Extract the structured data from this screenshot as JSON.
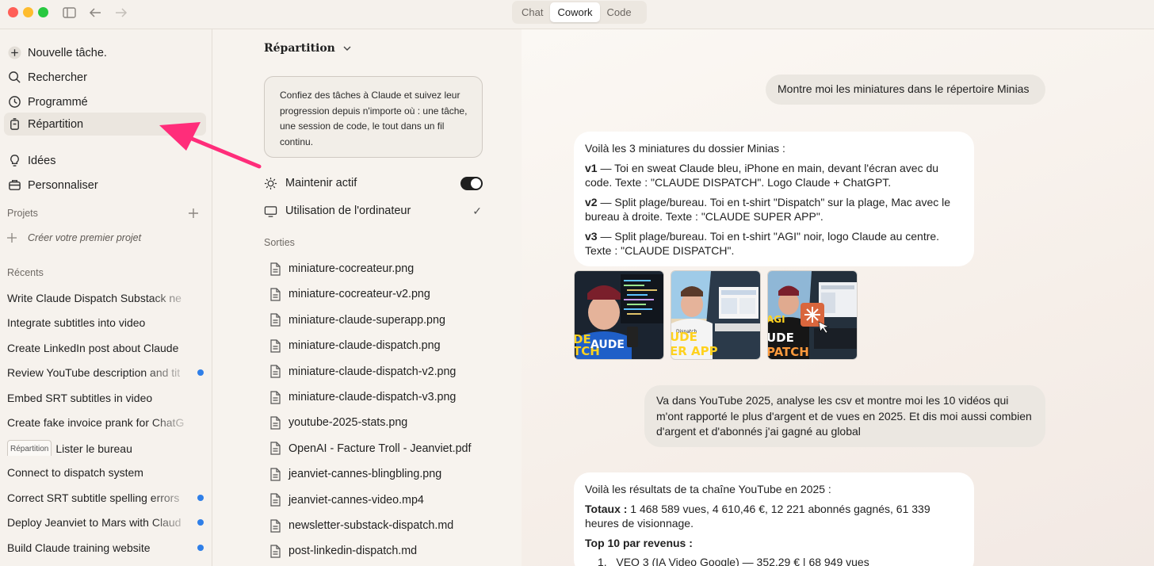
{
  "titlebar": {
    "tabs": [
      "Chat",
      "Cowork",
      "Code"
    ],
    "active_tab": "Cowork"
  },
  "sidebar": {
    "nav": [
      {
        "label": "Nouvelle tâche.",
        "icon": "plus-icon"
      },
      {
        "label": "Rechercher",
        "icon": "search-icon"
      },
      {
        "label": "Programmé",
        "icon": "clock-icon"
      },
      {
        "label": "Répartition",
        "icon": "dispatch-icon"
      },
      {
        "label": "Idées",
        "icon": "lightbulb-icon"
      },
      {
        "label": "Personnaliser",
        "icon": "briefcase-icon"
      }
    ],
    "projects_label": "Projets",
    "create_project": "Créer votre premier projet",
    "recents_label": "Récents",
    "recents": [
      {
        "label": "Write Claude Dispatch Substack ne",
        "dot": false
      },
      {
        "label": "Integrate subtitles into video",
        "dot": false
      },
      {
        "label": "Create LinkedIn post about Claude",
        "dot": false
      },
      {
        "label": "Review YouTube description and tit",
        "dot": true
      },
      {
        "label": "Embed SRT subtitles in video",
        "dot": false
      },
      {
        "label": "Create fake invoice prank for ChatG",
        "dot": false
      },
      {
        "label": "Lister le bureau",
        "tag": "Répartition",
        "dot": false
      },
      {
        "label": "Connect to dispatch system",
        "dot": false
      },
      {
        "label": "Correct SRT subtitle spelling errors",
        "dot": true
      },
      {
        "label": "Deploy Jeanviet to Mars with Claud",
        "dot": true
      },
      {
        "label": "Build Claude training website",
        "dot": true
      }
    ]
  },
  "middle": {
    "title": "Répartition",
    "info": "Confiez des tâches à Claude et suivez leur progression depuis n'importe où : une tâche, une session de code, le tout dans un fil continu.",
    "keep_active": "Maintenir actif",
    "computer_use": "Utilisation de l'ordinateur",
    "outputs_label": "Sorties",
    "files": [
      "miniature-cocreateur.png",
      "miniature-cocreateur-v2.png",
      "miniature-claude-superapp.png",
      "miniature-claude-dispatch.png",
      "miniature-claude-dispatch-v2.png",
      "miniature-claude-dispatch-v3.png",
      "youtube-2025-stats.png",
      "OpenAI - Facture Troll - Jeanviet.pdf",
      "jeanviet-cannes-blingbling.png",
      "jeanviet-cannes-video.mp4",
      "newsletter-substack-dispatch.md",
      "post-linkedin-dispatch.md"
    ]
  },
  "chat": {
    "user1": "Montre moi les miniatures dans le répertoire Minias",
    "ai1": {
      "intro": "Voilà les 3 miniatures du dossier Minias :",
      "items": [
        {
          "key": "v1",
          "text": " — Toi en sweat Claude bleu, iPhone en main, devant l'écran avec du code. Texte : \"CLAUDE DISPATCH\". Logo Claude + ChatGPT."
        },
        {
          "key": "v2",
          "text": " — Split plage/bureau. Toi en t-shirt \"Dispatch\" sur la plage, Mac avec le bureau à droite. Texte : \"CLAUDE SUPER APP\"."
        },
        {
          "key": "v3",
          "text": " — Split plage/bureau. Toi en t-shirt \"AGI\" noir, logo Claude au centre. Texte : \"CLAUDE DISPATCH\"."
        }
      ]
    },
    "thumbnails": [
      {
        "caption_l1": "DE",
        "caption_l2": "TCH",
        "caption_r": "AUDE",
        "shirt": "",
        "accent": "#ffd21f"
      },
      {
        "caption_l1": "UDE",
        "caption_l2": "ER APP",
        "caption_r": "",
        "shirt": "Dispatch",
        "accent": "#ffd21f"
      },
      {
        "caption_l1": "UDE",
        "caption_l2": "PATCH",
        "caption_r": "",
        "shirt": "AGI",
        "accent": "#ff9a3c"
      }
    ],
    "user2": "Va dans YouTube 2025, analyse les csv et montre moi les 10 vidéos qui m'ont rapporté le plus d'argent et de vues en 2025. Et dis moi aussi combien d'argent et d'abonnés j'ai gagné au global",
    "ai2": {
      "intro": "Voilà les résultats de ta chaîne YouTube en 2025 :",
      "totals_label": "Totaux :",
      "totals": " 1 468 589 vues, 4 610,46 €, 12 221 abonnés gagnés, 61 339 heures de visionnage.",
      "top_label": "Top 10 par revenus :",
      "first_num": "1.",
      "first_item": "VEO 3 (IA Video Google) — 352,29 € | 68 949 vues"
    }
  }
}
